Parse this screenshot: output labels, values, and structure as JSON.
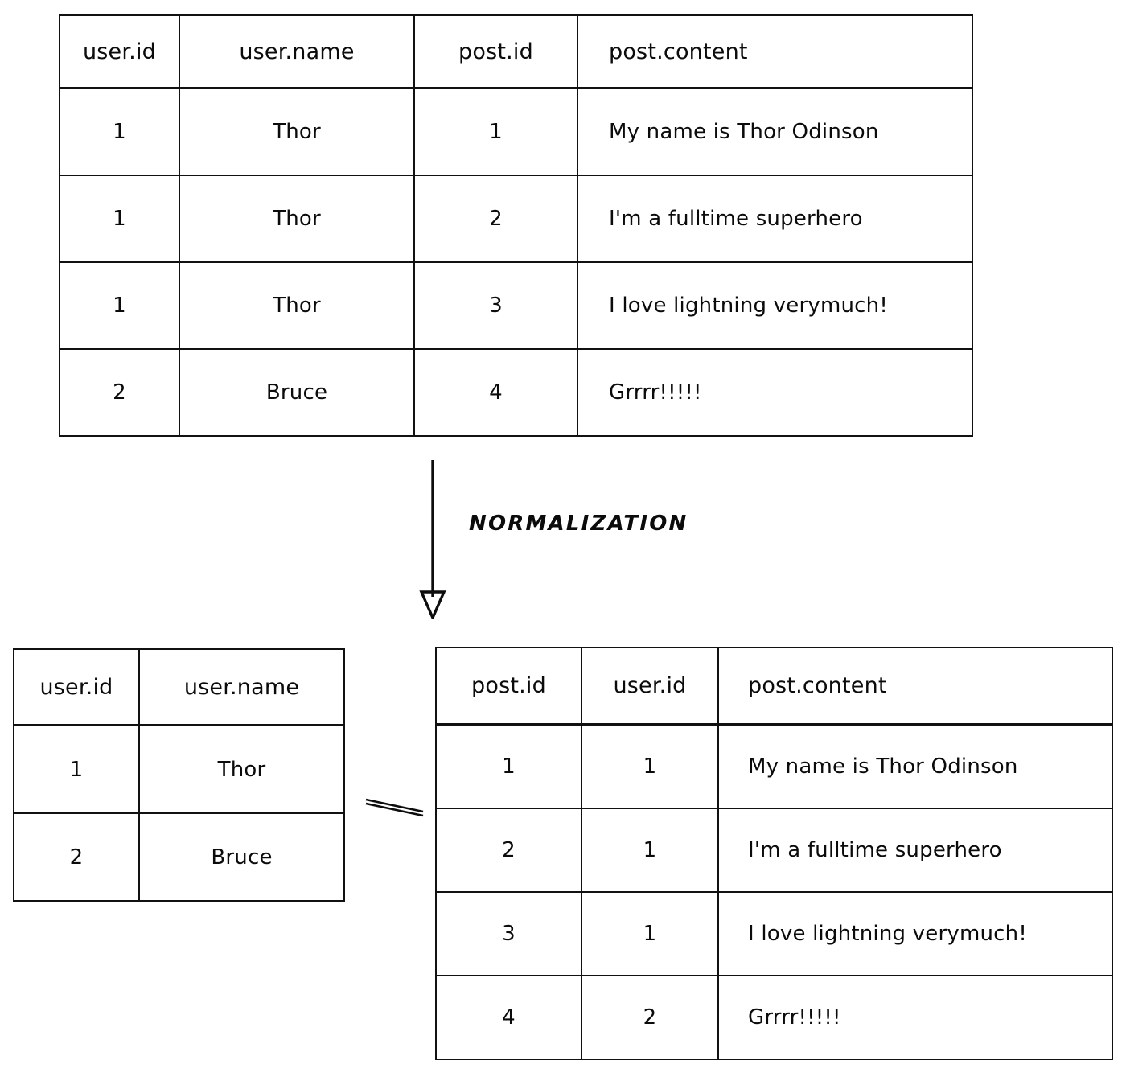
{
  "diagram": {
    "title_text": "NORMALIZATION",
    "arrow_direction": "down"
  },
  "denormalized_table": {
    "name": "joined-user-post-table",
    "columns": [
      "user.id",
      "user.name",
      "post.id",
      "post.content"
    ],
    "rows": [
      [
        "1",
        "Thor",
        "1",
        "My name is Thor Odinson"
      ],
      [
        "1",
        "Thor",
        "2",
        "I'm a fulltime superhero"
      ],
      [
        "1",
        "Thor",
        "3",
        "I love lightning verymuch!"
      ],
      [
        "2",
        "Bruce",
        "4",
        "Grrrr!!!!!"
      ]
    ]
  },
  "users_table": {
    "name": "users-table",
    "columns": [
      "user.id",
      "user.name"
    ],
    "rows": [
      [
        "1",
        "Thor"
      ],
      [
        "2",
        "Bruce"
      ]
    ]
  },
  "posts_table": {
    "name": "posts-table",
    "columns": [
      "post.id",
      "user.id",
      "post.content"
    ],
    "rows": [
      [
        "1",
        "1",
        "My name is Thor Odinson"
      ],
      [
        "2",
        "1",
        "I'm a fulltime superhero"
      ],
      [
        "3",
        "1",
        "I love lightning verymuch!"
      ],
      [
        "4",
        "2",
        "Grrrr!!!!!"
      ]
    ]
  },
  "colors": {
    "ink": "#0b0b0b",
    "paper": "#ffffff"
  }
}
